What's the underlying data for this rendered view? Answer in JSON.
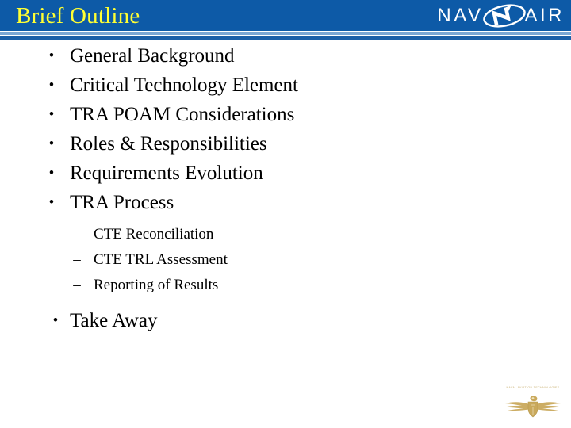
{
  "slide": {
    "title": "Brief Outline",
    "title_color": "#ffff33",
    "header_color": "#0d5aa7",
    "background_color": "#ffffff"
  },
  "logo": {
    "name": "navair-logo",
    "text_left": "NAV",
    "text_right": "AIR",
    "emblem_icon": "navair-swoosh-icon",
    "color": "#ffffff"
  },
  "outline": {
    "bullets": [
      {
        "marker": "•",
        "label": "General Background"
      },
      {
        "marker": "•",
        "label": "Critical Technology Element"
      },
      {
        "marker": "•",
        "label": "TRA POAM Considerations"
      },
      {
        "marker": "•",
        "label": "Roles & Responsibilities"
      },
      {
        "marker": "•",
        "label": "Requirements Evolution"
      },
      {
        "marker": "•",
        "label": "TRA Process"
      }
    ],
    "sub_bullets": [
      {
        "marker": "–",
        "label": "CTE Reconciliation"
      },
      {
        "marker": "–",
        "label": "CTE TRL Assessment"
      },
      {
        "marker": "–",
        "label": "Reporting of Results"
      }
    ],
    "final_bullets": [
      {
        "marker": "•",
        "label": "Take Away"
      }
    ]
  },
  "footer": {
    "rule_color": "#d9c98f",
    "emblem_caption": "NAVAL AVIATION TECHNOLOGIES",
    "emblem_icon": "naval-aviator-wings-icon",
    "emblem_color": "#c9a95c"
  }
}
